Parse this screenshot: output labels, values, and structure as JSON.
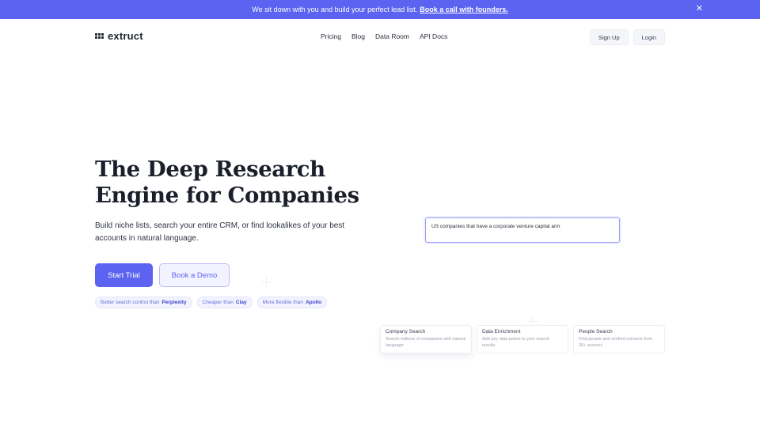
{
  "banner": {
    "message": "We sit down with you and build your perfect lead list.",
    "cta": "Book a call with founders.",
    "close_icon": "close-icon"
  },
  "header": {
    "logo_text": "extruct",
    "nav": [
      "Pricing",
      "Blog",
      "Data Room",
      "API Docs"
    ],
    "sign_up": "Sign Up",
    "login": "Login"
  },
  "hero": {
    "title": "The Deep Research Engine for Companies",
    "subtitle": "Build niche lists, search your entire CRM, or find lookalikes of your best accounts in natural language.",
    "primary_cta": "Start Trial",
    "secondary_cta": "Book a Demo",
    "pills": [
      {
        "text": "Better search control than",
        "brand": "Perplexity"
      },
      {
        "text": "Cheaper than",
        "brand": "Clay"
      },
      {
        "text": "More flexible than",
        "brand": "Apollo"
      }
    ]
  },
  "demo": {
    "query": "US companies that have a corporate venture capital arm",
    "cards": [
      {
        "title": "Company Search",
        "desc": "Search millions of companies with natural language"
      },
      {
        "title": "Data Enrichment",
        "desc": "Add any data points to your search results"
      },
      {
        "title": "People Search",
        "desc": "Find people and verified contacts from 20+ sources"
      }
    ]
  },
  "colors": {
    "accent": "#5b63f0",
    "text": "#1f2430"
  }
}
